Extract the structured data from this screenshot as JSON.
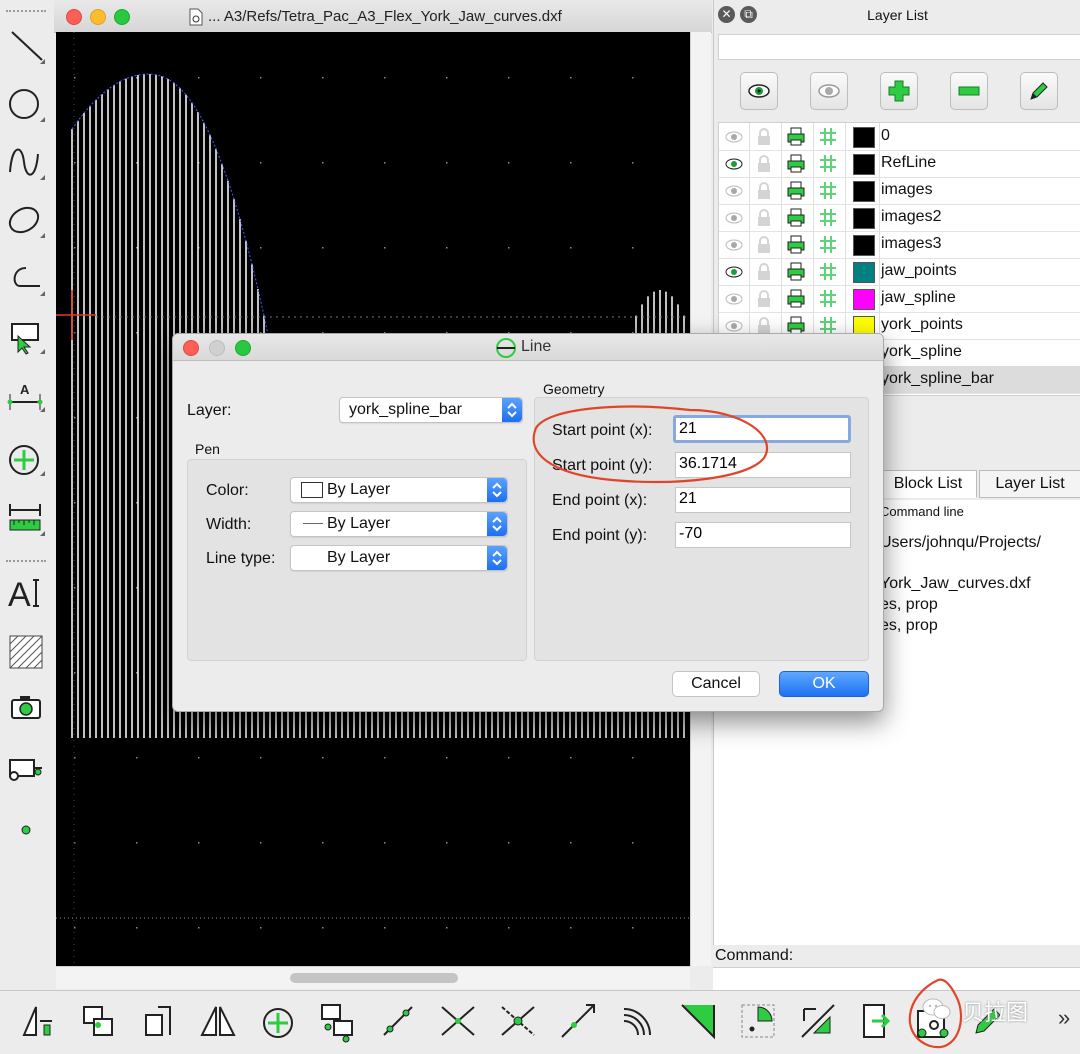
{
  "drawing_window": {
    "title": "... A3/Refs/Tetra_Pac_A3_Flex_York_Jaw_curves.dxf"
  },
  "layer_list": {
    "title": "Layer List",
    "filter_value": "",
    "layers": [
      {
        "name": "0",
        "color": "#000000",
        "visible": false
      },
      {
        "name": "RefLine",
        "color": "#000000",
        "visible": true
      },
      {
        "name": "images",
        "color": "#000000",
        "visible": false
      },
      {
        "name": "images2",
        "color": "#000000",
        "visible": false
      },
      {
        "name": "images3",
        "color": "#000000",
        "visible": false
      },
      {
        "name": "jaw_points",
        "color": "#008080",
        "visible": true
      },
      {
        "name": "jaw_spline",
        "color": "#ff00ff",
        "visible": false
      },
      {
        "name": "york_points",
        "color": "#ffff00",
        "visible": false
      },
      {
        "name": "york_spline",
        "color": "#000000",
        "visible": false
      },
      {
        "name": "york_spline_bar",
        "color": "#000000",
        "visible": false,
        "selected": true
      }
    ]
  },
  "tabs": {
    "block_list": "Block List",
    "layer_list": "Layer List"
  },
  "command_dock": {
    "title": "Command line",
    "lines": [
      "Users/johnqu/Projects/",
      "York_Jaw_curves.dxf",
      "es, prop",
      "es, prop"
    ],
    "command_label": "Command:",
    "command_value": ""
  },
  "dialog": {
    "title": "Line",
    "layer_label": "Layer:",
    "layer_value": "york_spline_bar",
    "pen_group": "Pen",
    "color_label": "Color:",
    "color_value": "By Layer",
    "width_label": "Width:",
    "width_value": "By Layer",
    "linetype_label": "Line type:",
    "linetype_value": "By Layer",
    "geometry_group": "Geometry",
    "start_x_label": "Start point (x):",
    "start_x_value": "21",
    "start_y_label": "Start point (y):",
    "start_y_value": "36.1714",
    "end_x_label": "End point (x):",
    "end_x_value": "21",
    "end_y_label": "End point (y):",
    "end_y_value": "-70",
    "cancel_label": "Cancel",
    "ok_label": "OK"
  },
  "watermark_text": "贝拉图",
  "colors": {
    "accent_green": "#2ecc40",
    "ok_blue": "#1e6ff0",
    "annotation_red": "#e0452a"
  }
}
